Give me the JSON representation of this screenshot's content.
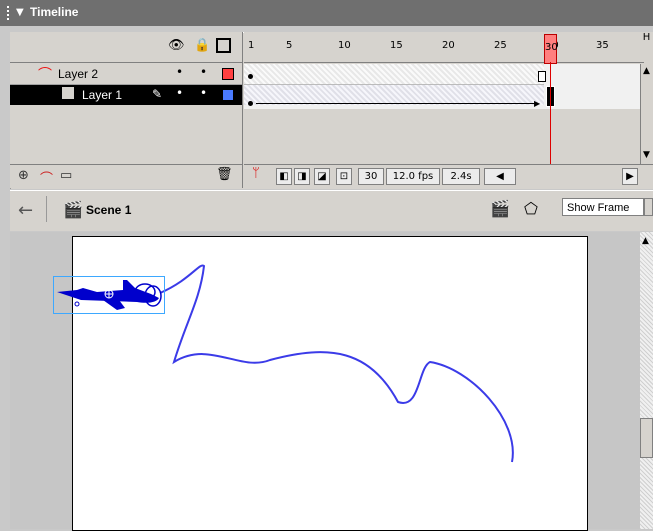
{
  "timeline": {
    "title": "Timeline",
    "layers": [
      {
        "name": "Layer 2",
        "color": "#ff4040"
      },
      {
        "name": "Layer 1",
        "color": "#4a7bff"
      }
    ],
    "ruler_numbers": [
      "1",
      "5",
      "10",
      "15",
      "20",
      "25",
      "30",
      "35"
    ],
    "current_frame": "30",
    "frame_rate": "12.0 fps",
    "elapsed": "2.4s"
  },
  "scene": {
    "label": "Scene 1",
    "zoom": "Show Frame"
  },
  "colors": {
    "path": "#3b3be8",
    "plane": "#0000cc",
    "playhead": "#ff7f7f",
    "selection": "#3da8ff"
  },
  "icons": {
    "eye": "eye-icon",
    "lock": "lock-icon",
    "outline": "outline-icon",
    "trash": "trash-icon",
    "back": "back-arrow-icon",
    "scene": "scene-icon"
  }
}
